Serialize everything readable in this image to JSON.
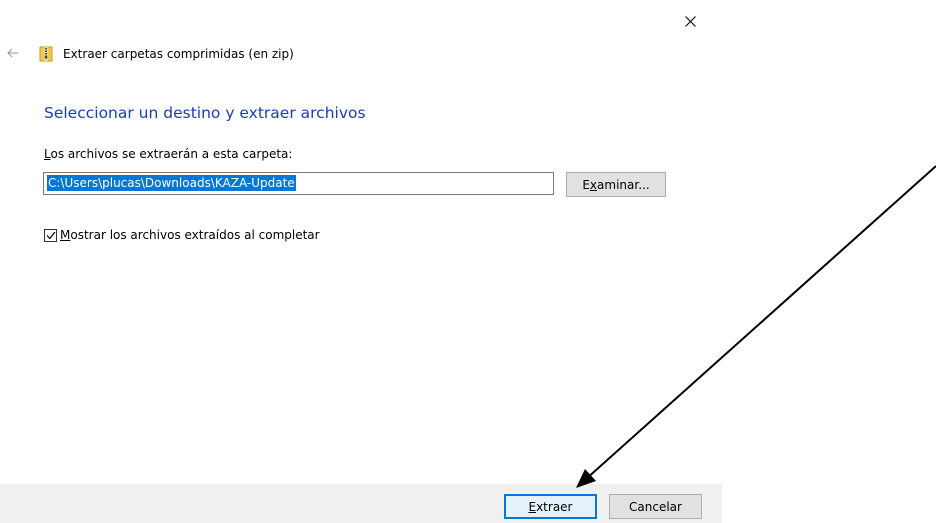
{
  "window": {
    "title": "Extraer carpetas comprimidas (en zip)",
    "close_glyph": "×",
    "back_glyph": "←"
  },
  "main": {
    "heading": "Seleccionar un destino y extraer archivos",
    "destination_label": {
      "access_key": "L",
      "rest": "os archivos se extraerán a esta carpeta:"
    },
    "destination_path": "C:\\Users\\plucas\\Downloads\\KAZA-Update",
    "browse_button": {
      "pre": "E",
      "access_key": "x",
      "rest": "aminar..."
    },
    "show_files_checkbox": {
      "checked": true,
      "access_key": "M",
      "rest": "ostrar los archivos extraídos al completar"
    }
  },
  "footer": {
    "extract_button": {
      "access_key": "E",
      "rest": "xtraer"
    },
    "cancel_button": "Cancelar"
  },
  "colors": {
    "heading": "#1a3fa8",
    "selection": "#0078d7",
    "footer_bg": "#f0f0f0",
    "button_bg": "#e1e1e1",
    "annotation_arrow": "#000000"
  },
  "icons": {
    "window_icon": "zip-folder-icon",
    "back": "back-arrow-icon",
    "close": "close-icon",
    "annotation": "annotation-arrow"
  }
}
